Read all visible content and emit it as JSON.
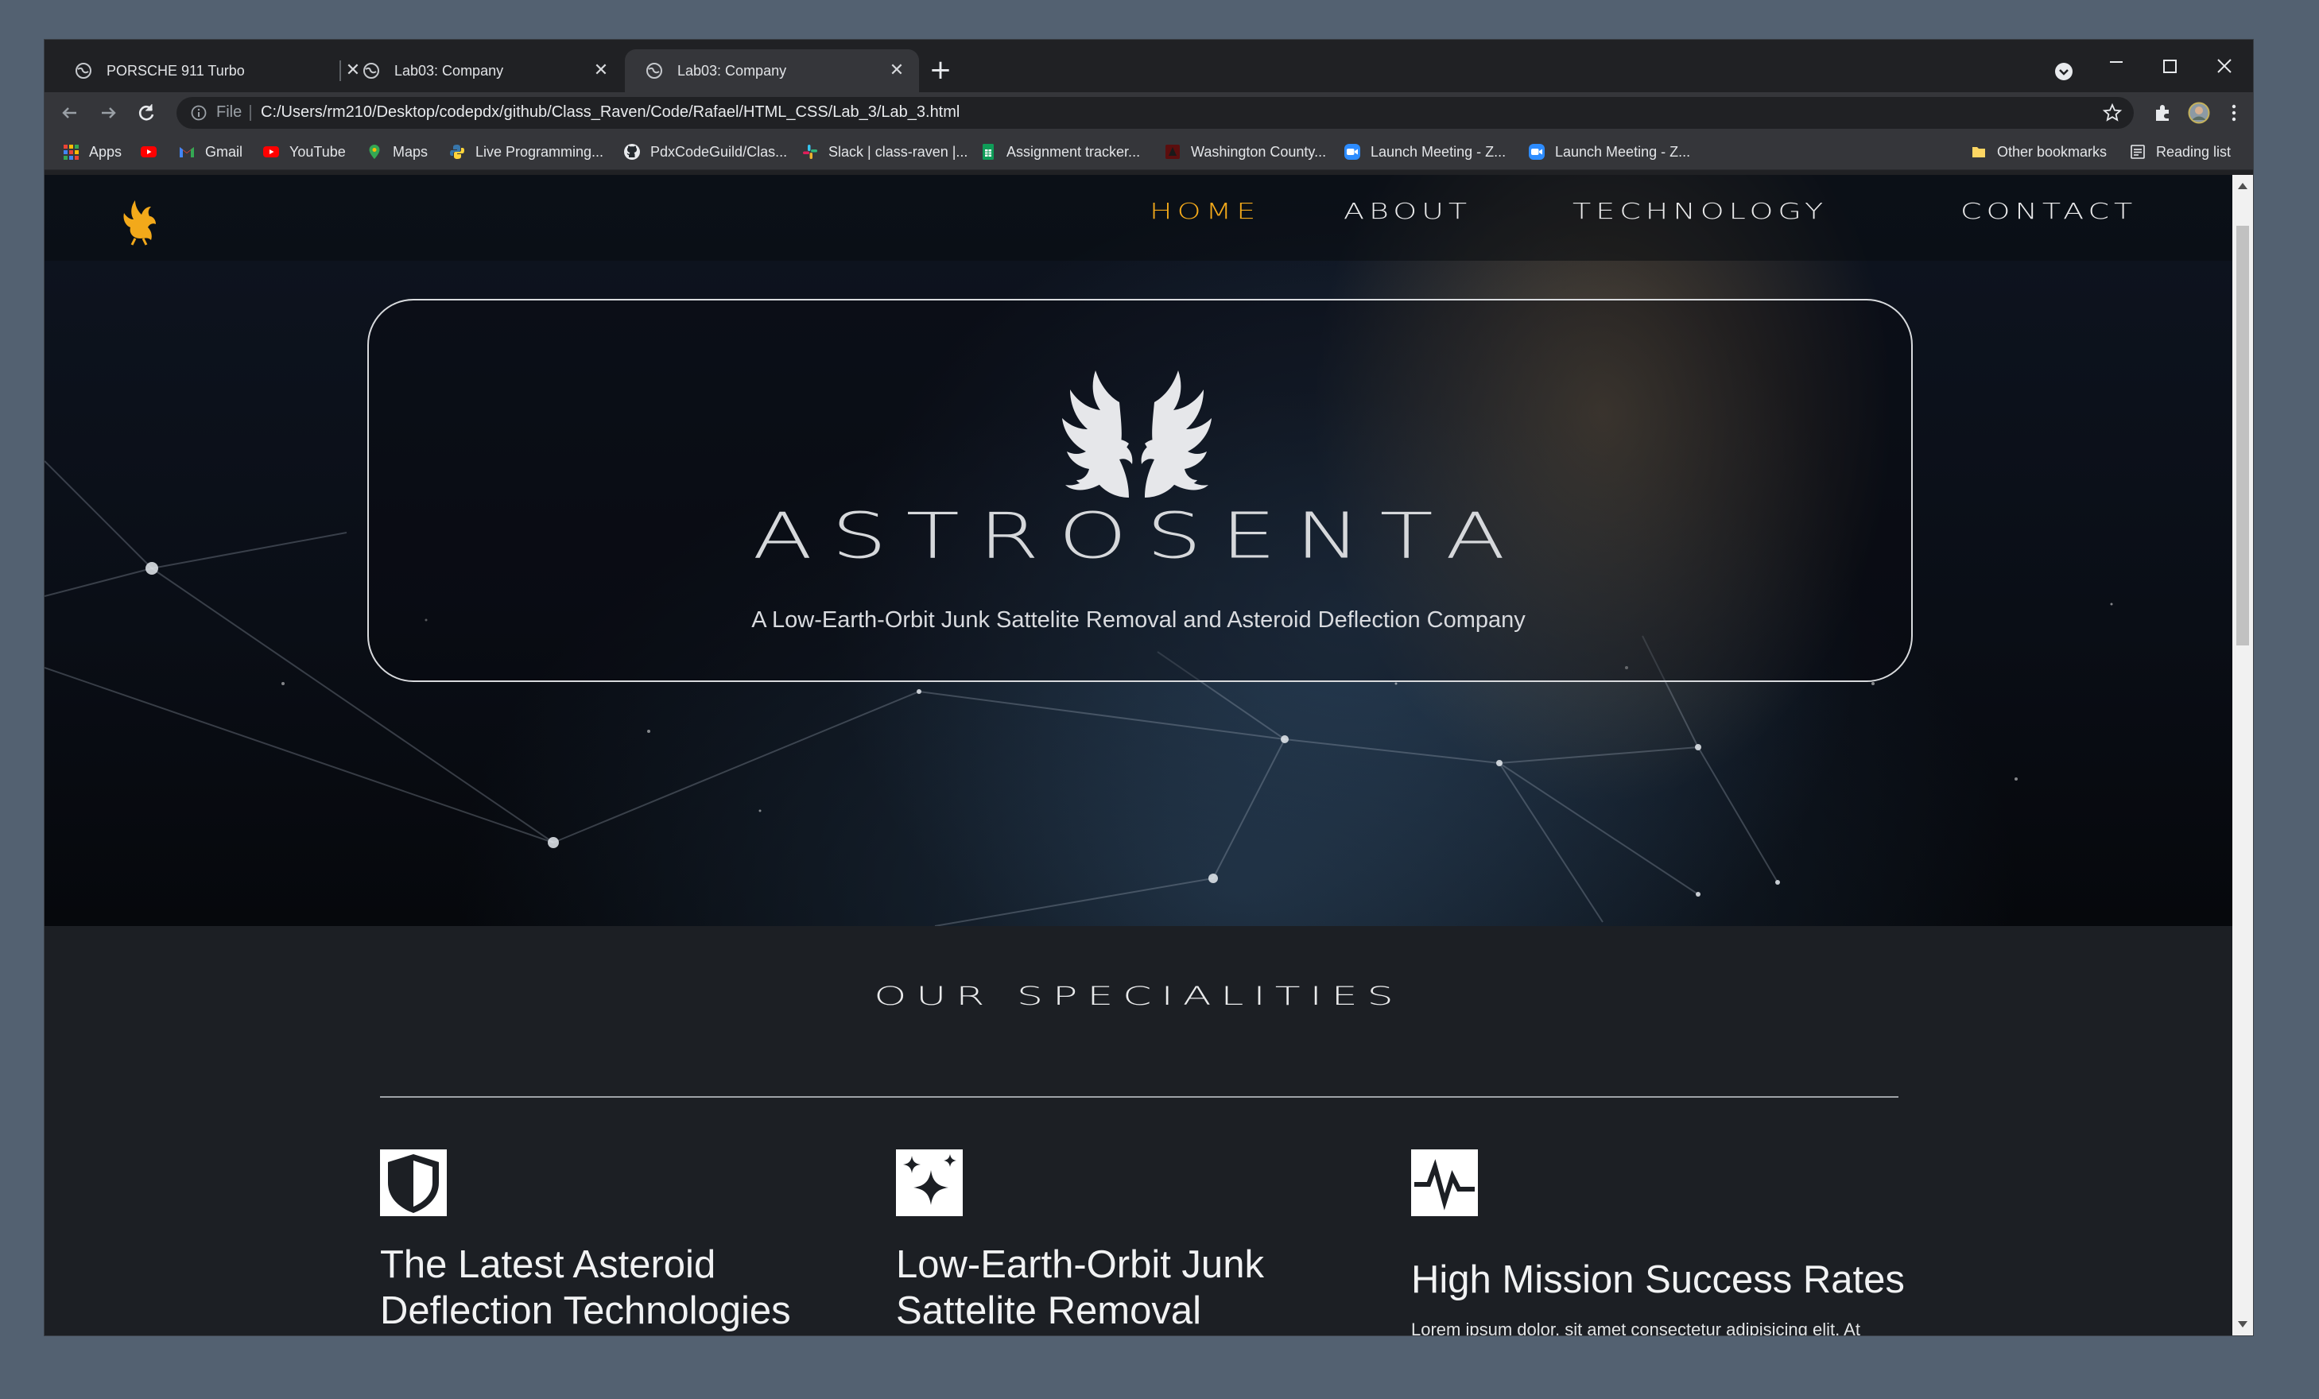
{
  "browser": {
    "tabs": [
      {
        "title": "PORSCHE 911 Turbo",
        "active": false
      },
      {
        "title": "Lab03: Company",
        "active": false
      },
      {
        "title": "Lab03: Company",
        "active": true
      }
    ],
    "address": {
      "scheme_label": "File",
      "url": "C:/Users/rm210/Desktop/codepdx/github/Class_Raven/Code/Rafael/HTML_CSS/Lab_3/Lab_3.html"
    },
    "bookmarks": [
      {
        "label": "Apps",
        "icon": "apps-grid-icon"
      },
      {
        "label": "",
        "icon": "youtube-icon"
      },
      {
        "label": "Gmail",
        "icon": "gmail-icon"
      },
      {
        "label": "YouTube",
        "icon": "youtube-icon"
      },
      {
        "label": "Maps",
        "icon": "maps-pin-icon"
      },
      {
        "label": "Live Programming...",
        "icon": "python-icon"
      },
      {
        "label": "PdxCodeGuild/Clas...",
        "icon": "github-icon"
      },
      {
        "label": "Slack | class-raven |...",
        "icon": "slack-icon"
      },
      {
        "label": "Assignment tracker...",
        "icon": "sheets-icon"
      },
      {
        "label": "Washington County...",
        "icon": "county-icon"
      },
      {
        "label": "Launch Meeting - Z...",
        "icon": "zoom-icon"
      },
      {
        "label": "Launch Meeting - Z...",
        "icon": "zoom-icon"
      }
    ],
    "other_bookmarks": "Other bookmarks",
    "reading_list": "Reading list"
  },
  "site": {
    "nav": [
      {
        "label": "HOME",
        "active": true
      },
      {
        "label": "ABOUT",
        "active": false
      },
      {
        "label": "TECHNOLOGY",
        "active": false
      },
      {
        "label": "CONTACT",
        "active": false
      }
    ],
    "hero": {
      "title": "ASTROSENTA",
      "subtitle": "A Low-Earth-Orbit Junk Sattelite Removal and Asteroid Deflection Company"
    },
    "specialities": {
      "heading": "OUR SPECIALITIES",
      "items": [
        {
          "icon": "shield-icon",
          "title": "The Latest Asteroid Deflection Technologies",
          "body": ""
        },
        {
          "icon": "sparkles-icon",
          "title": "Low-Earth-Orbit Junk Sattelite Removal",
          "body": ""
        },
        {
          "icon": "pulse-icon",
          "title": "High Mission Success Rates",
          "body": "Lorem ipsum dolor, sit amet consectetur adipisicing elit. At"
        }
      ]
    }
  },
  "colors": {
    "accent_nav_active": "#f3a91a",
    "browser_frame": "#202124",
    "toolbar": "#35363a",
    "section_bg": "#1c1f24"
  }
}
